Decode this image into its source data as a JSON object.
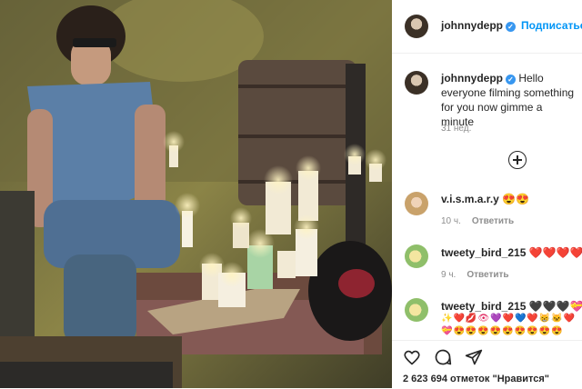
{
  "post": {
    "username": "johnnydepp",
    "follow_label": "Подписаться",
    "caption_text": "Hello everyone filming something for you now gimme a minute",
    "age": "31 нед."
  },
  "comments": [
    {
      "username": "v.i.s.m.a.r.y",
      "text": "😍😍",
      "age": "10 ч.",
      "reply": "Ответить"
    },
    {
      "username": "tweety_bird_215",
      "text": "❤️❤️❤️❤️",
      "age": "9 ч.",
      "reply": "Ответить"
    },
    {
      "username": "tweety_bird_215",
      "text": "🖤🖤🖤💝🖤",
      "line2": "✨❤️💋👁💜❤️💙❤️😸🐱❤️",
      "line3": "💝😍😍😍😍😍😍😍😍😍"
    }
  ],
  "footer": {
    "likes_count": "2 623 694",
    "likes_word": "отметок",
    "likes_suffix": "\"Нравится\""
  },
  "icons": [
    "heart-icon",
    "comment-icon",
    "share-icon",
    "add-comment-icon",
    "verified-icon"
  ],
  "colors": {
    "accent": "#0095f6",
    "verified": "#3897f0",
    "meta": "#8e8e8e"
  }
}
